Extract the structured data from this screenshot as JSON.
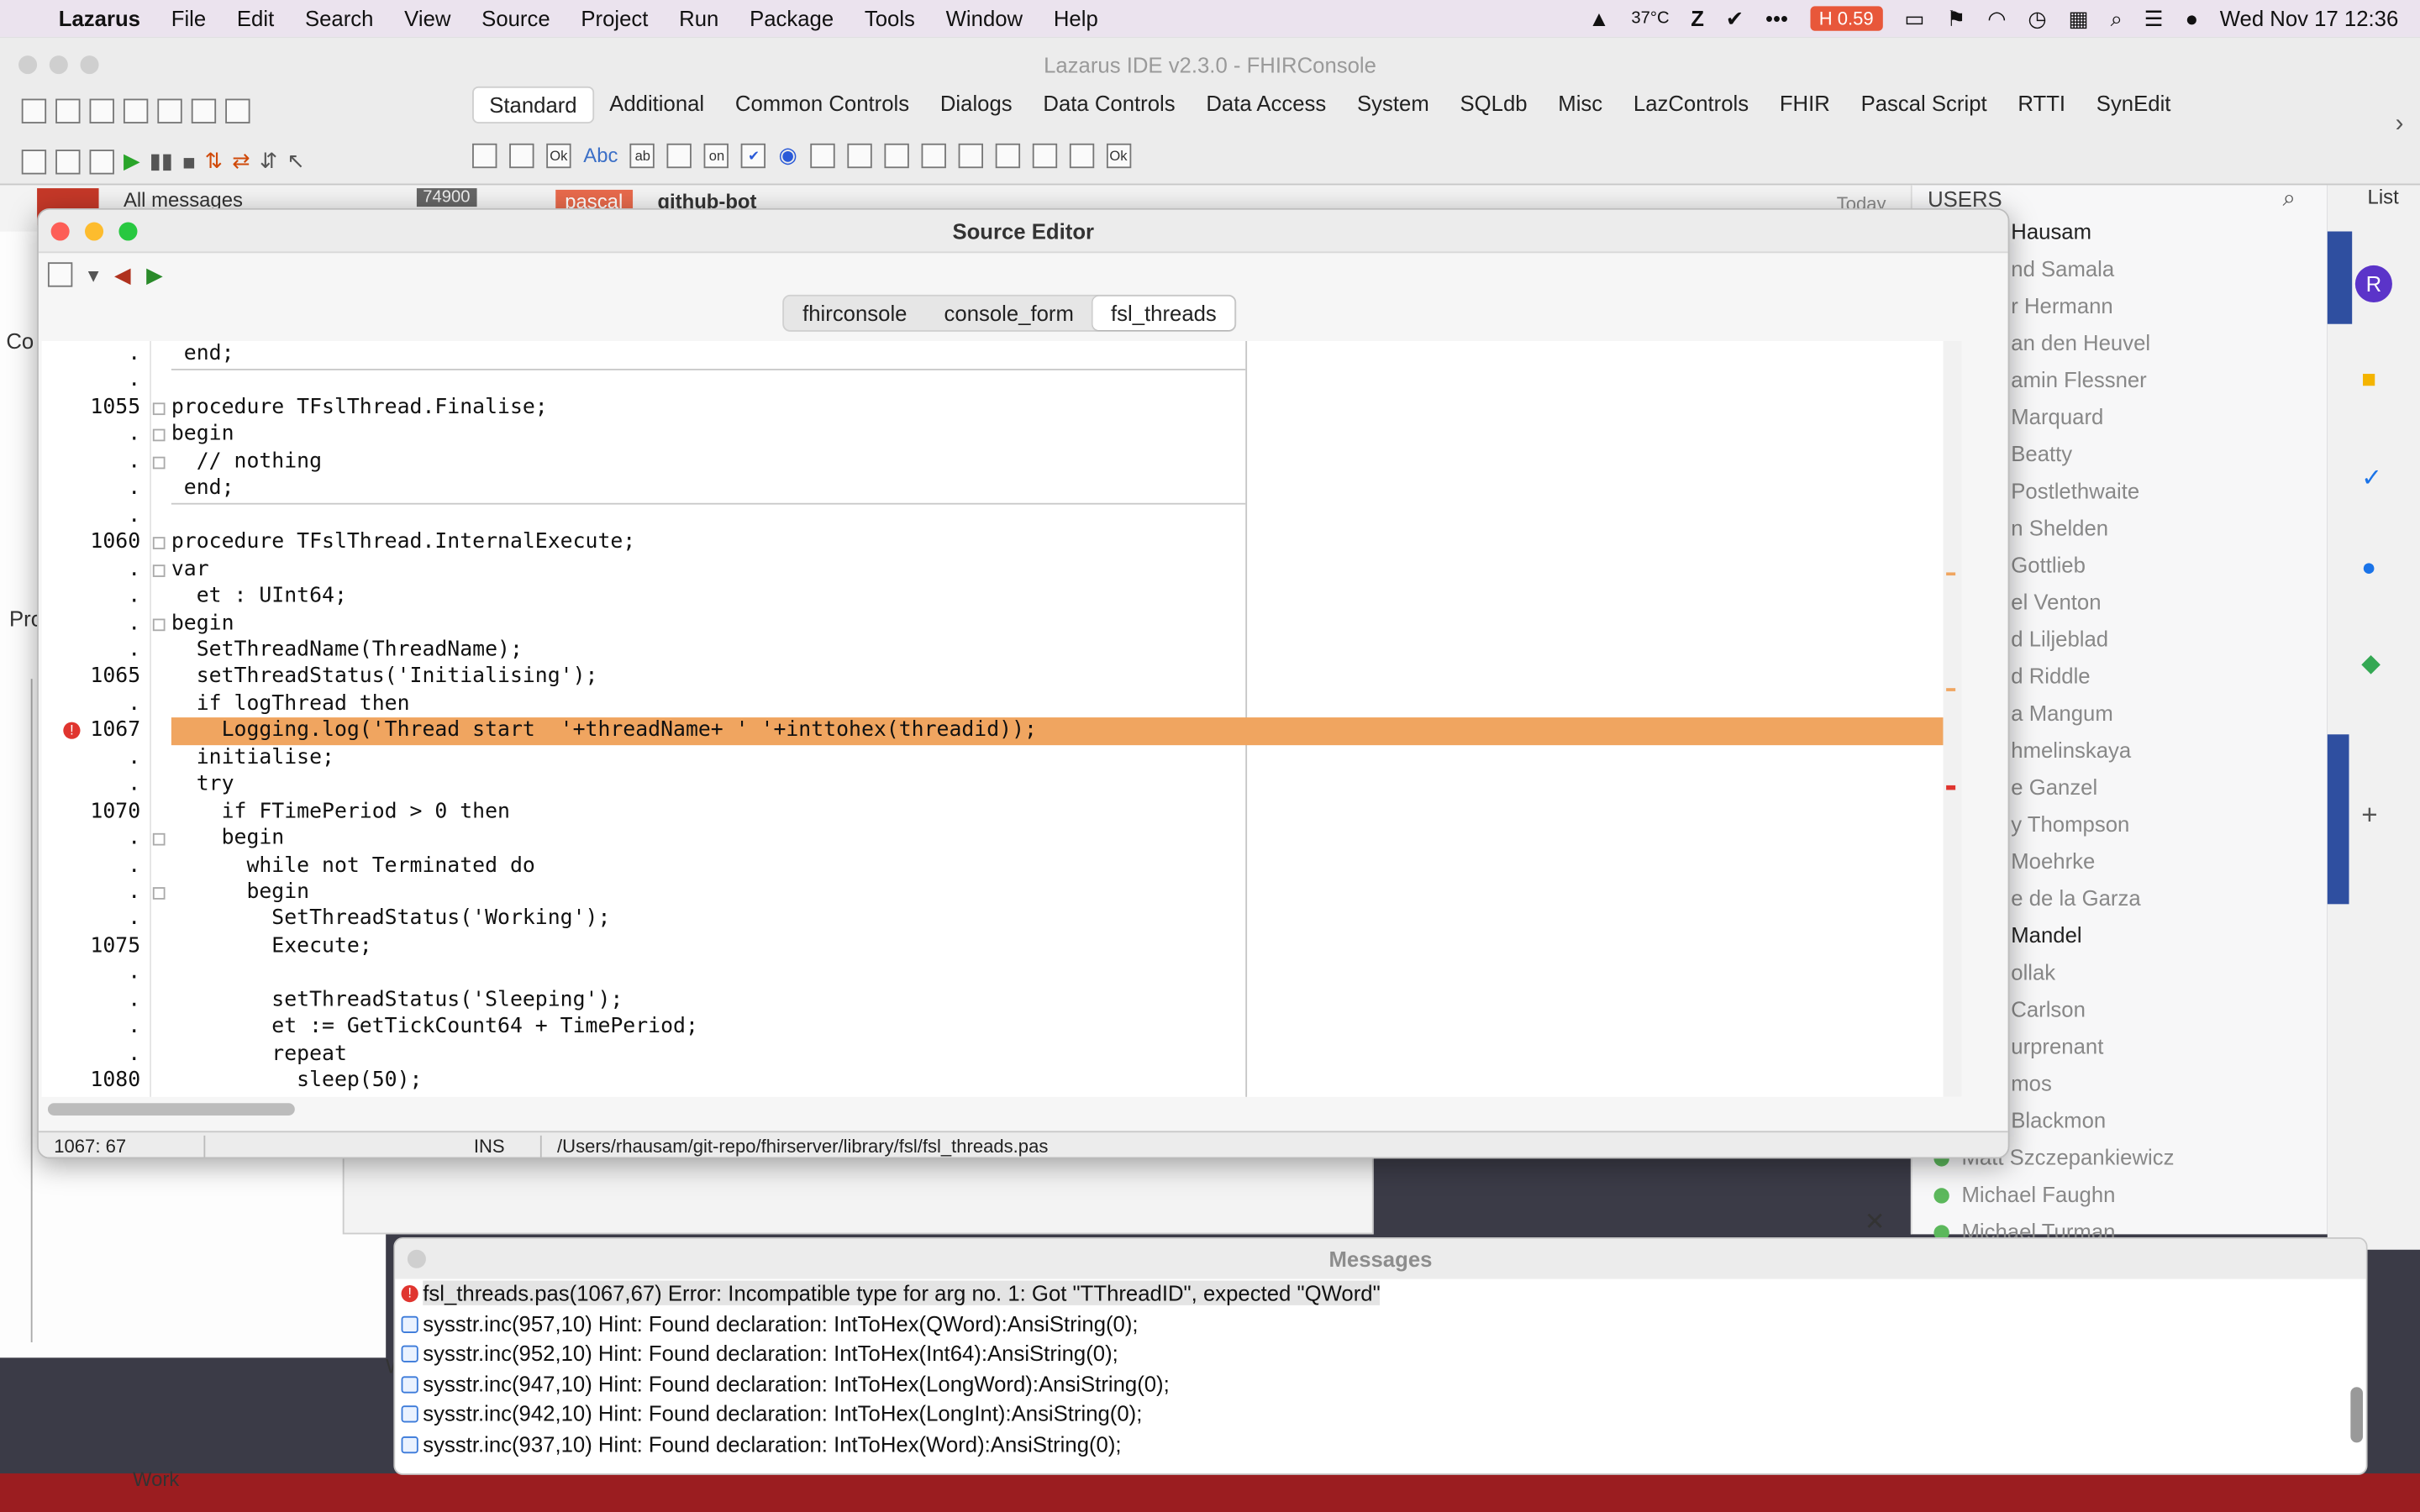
{
  "menubar": {
    "app": "Lazarus",
    "items": [
      "File",
      "Edit",
      "Search",
      "View",
      "Source",
      "Project",
      "Run",
      "Package",
      "Tools",
      "Window",
      "Help"
    ],
    "temp": "37°C",
    "h_value": "0.59",
    "clock": "Wed Nov 17  12:36"
  },
  "ide": {
    "title": "Lazarus IDE v2.3.0 - FHIRConsole",
    "palette_tabs": [
      "Standard",
      "Additional",
      "Common Controls",
      "Dialogs",
      "Data Controls",
      "Data Access",
      "System",
      "SQLdb",
      "Misc",
      "LazControls",
      "FHIR",
      "Pascal Script",
      "RTTI",
      "SynEdit"
    ],
    "active_tab": "Standard"
  },
  "background": {
    "all_messages": "All messages",
    "msg_count": "74900",
    "chip1": "pascal",
    "chip2": "github-bot",
    "today": "Today",
    "users_header": "USERS",
    "list_label": "List",
    "left_label1": "Co",
    "left_label2": "Pro",
    "left_label3": "W",
    "work_label": "Work"
  },
  "editor": {
    "title": "Source Editor",
    "tabs": [
      "fhirconsole",
      "console_form",
      "fsl_threads"
    ],
    "active_tab": "fsl_threads",
    "status_pos": "1067:  67",
    "status_mode": "INS",
    "status_path": "/Users/rhausam/git-repo/fhirserver/library/fsl/fsl_threads.pas",
    "lines": [
      {
        "n": ".",
        "t": " end;"
      },
      {
        "n": ".",
        "t": ""
      },
      {
        "n": "1055",
        "t": "procedure TFslThread.Finalise;"
      },
      {
        "n": ".",
        "t": "begin"
      },
      {
        "n": ".",
        "t": "  // nothing"
      },
      {
        "n": ".",
        "t": " end;"
      },
      {
        "n": ".",
        "t": ""
      },
      {
        "n": "1060",
        "t": "procedure TFslThread.InternalExecute;"
      },
      {
        "n": ".",
        "t": "var"
      },
      {
        "n": ".",
        "t": "  et : UInt64;"
      },
      {
        "n": ".",
        "t": "begin"
      },
      {
        "n": ".",
        "t": "  SetThreadName(ThreadName);"
      },
      {
        "n": "1065",
        "t": "  setThreadStatus('Initialising');"
      },
      {
        "n": ".",
        "t": "  if logThread then"
      },
      {
        "n": "1067",
        "t": "    Logging.log('Thread start  '+threadName+ ' '+inttohex(threadid));"
      },
      {
        "n": ".",
        "t": "  initialise;"
      },
      {
        "n": ".",
        "t": "  try"
      },
      {
        "n": "1070",
        "t": "    if FTimePeriod > 0 then"
      },
      {
        "n": ".",
        "t": "    begin"
      },
      {
        "n": ".",
        "t": "      while not Terminated do"
      },
      {
        "n": ".",
        "t": "      begin"
      },
      {
        "n": ".",
        "t": "        SetThreadStatus('Working');"
      },
      {
        "n": "1075",
        "t": "        Execute;"
      },
      {
        "n": ".",
        "t": ""
      },
      {
        "n": ".",
        "t": "        setThreadStatus('Sleeping');"
      },
      {
        "n": ".",
        "t": "        et := GetTickCount64 + TimePeriod;"
      },
      {
        "n": ".",
        "t": "        repeat"
      },
      {
        "n": "1080",
        "t": "          sleep(50);"
      }
    ]
  },
  "messages": {
    "title": "Messages",
    "items": [
      {
        "type": "err",
        "text": "fsl_threads.pas(1067,67) Error: Incompatible type for arg no. 1: Got \"TThreadID\", expected \"QWord\""
      },
      {
        "type": "hint",
        "text": "sysstr.inc(957,10) Hint: Found declaration: IntToHex(QWord):AnsiString(0);"
      },
      {
        "type": "hint",
        "text": "sysstr.inc(952,10) Hint: Found declaration: IntToHex(Int64):AnsiString(0);"
      },
      {
        "type": "hint",
        "text": "sysstr.inc(947,10) Hint: Found declaration: IntToHex(LongWord):AnsiString(0);"
      },
      {
        "type": "hint",
        "text": "sysstr.inc(942,10) Hint: Found declaration: IntToHex(LongInt):AnsiString(0);"
      },
      {
        "type": "hint",
        "text": "sysstr.inc(937,10) Hint: Found declaration: IntToHex(Word):AnsiString(0);"
      }
    ]
  },
  "users": [
    {
      "name": "Hausam",
      "on": true
    },
    {
      "name": "nd Samala",
      "on": false
    },
    {
      "name": "r Hermann",
      "on": false
    },
    {
      "name": "an den Heuvel",
      "on": false
    },
    {
      "name": "amin Flessner",
      "on": false
    },
    {
      "name": "Marquard",
      "on": false
    },
    {
      "name": "Beatty",
      "on": false
    },
    {
      "name": "Postlethwaite",
      "on": false
    },
    {
      "name": "n Shelden",
      "on": false
    },
    {
      "name": "Gottlieb",
      "on": false
    },
    {
      "name": "el Venton",
      "on": false
    },
    {
      "name": "d Liljeblad",
      "on": false
    },
    {
      "name": "d Riddle",
      "on": false
    },
    {
      "name": "a Mangum",
      "on": false
    },
    {
      "name": "hmelinskaya",
      "on": false
    },
    {
      "name": "e Ganzel",
      "on": false
    },
    {
      "name": "y Thompson",
      "on": false
    },
    {
      "name": "Moehrke",
      "on": false
    },
    {
      "name": "e de la Garza",
      "on": false
    },
    {
      "name": "Mandel",
      "on": true
    },
    {
      "name": "ollak",
      "on": false
    },
    {
      "name": "Carlson",
      "on": false
    },
    {
      "name": "urprenant",
      "on": false
    },
    {
      "name": "mos",
      "on": false
    },
    {
      "name": "Blackmon",
      "on": false
    },
    {
      "name": "Matt Szczepankiewicz",
      "on": false
    },
    {
      "name": "Michael Faughn",
      "on": false
    },
    {
      "name": "Michael Turman",
      "on": false
    }
  ],
  "colors": {
    "highlight": "#f0a560",
    "error": "#e0352f",
    "string": "#1a3bd0"
  }
}
